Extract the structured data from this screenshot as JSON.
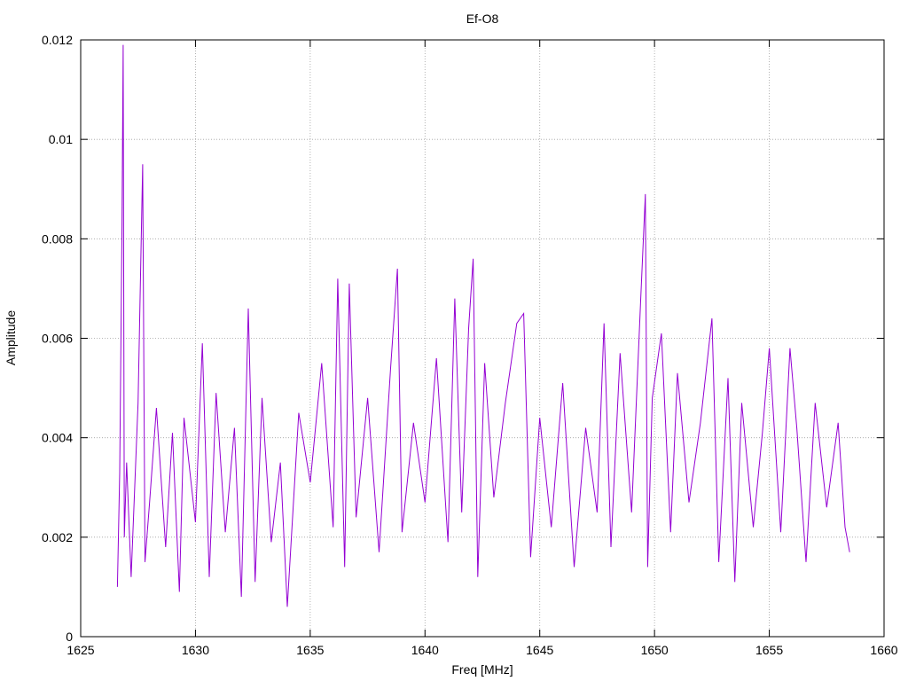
{
  "chart_data": {
    "type": "line",
    "title": "Ef-O8",
    "xlabel": "Freq [MHz]",
    "ylabel": "Amplitude",
    "xlim": [
      1625,
      1660
    ],
    "ylim": [
      0,
      0.012
    ],
    "xticks": [
      1625,
      1630,
      1635,
      1640,
      1645,
      1650,
      1655,
      1660
    ],
    "yticks": [
      0,
      0.002,
      0.004,
      0.006,
      0.008,
      0.01,
      0.012
    ],
    "xtick_labels": [
      "1625",
      "1630",
      "1635",
      "1640",
      "1645",
      "1650",
      "1655",
      "1660"
    ],
    "ytick_labels": [
      "0",
      "0.002",
      "0.004",
      "0.006",
      "0.008",
      "0.01",
      "0.012"
    ],
    "grid": true,
    "legend": "none",
    "line_color": "#9400d3",
    "series": [
      {
        "x": [
          1626.6,
          1626.7,
          1626.8,
          1626.85,
          1626.9,
          1627.0,
          1627.2,
          1627.5,
          1627.7,
          1627.8,
          1628.0,
          1628.3,
          1628.7,
          1629.0,
          1629.3,
          1629.5,
          1630.0,
          1630.3,
          1630.6,
          1630.9,
          1631.3,
          1631.7,
          1632.0,
          1632.3,
          1632.6,
          1632.9,
          1633.3,
          1633.7,
          1634.0,
          1634.5,
          1635.0,
          1635.5,
          1636.0,
          1636.2,
          1636.5,
          1636.7,
          1637.0,
          1637.5,
          1638.0,
          1638.5,
          1638.8,
          1639.0,
          1639.5,
          1640.0,
          1640.5,
          1641.0,
          1641.3,
          1641.6,
          1641.9,
          1642.1,
          1642.3,
          1642.6,
          1643.0,
          1643.5,
          1644.0,
          1644.3,
          1644.6,
          1645.0,
          1645.5,
          1646.0,
          1646.5,
          1647.0,
          1647.5,
          1647.8,
          1648.1,
          1648.5,
          1649.0,
          1649.4,
          1649.6,
          1649.7,
          1649.9,
          1650.3,
          1650.7,
          1651.0,
          1651.5,
          1652.0,
          1652.5,
          1652.8,
          1653.2,
          1653.5,
          1653.8,
          1654.3,
          1654.7,
          1655.0,
          1655.5,
          1655.9,
          1656.2,
          1656.6,
          1657.0,
          1657.5,
          1658.0,
          1658.3,
          1658.5
        ],
        "y": [
          0.001,
          0.0033,
          0.0083,
          0.0119,
          0.002,
          0.0035,
          0.0012,
          0.0047,
          0.0095,
          0.0015,
          0.0027,
          0.0046,
          0.0018,
          0.0041,
          0.0009,
          0.0044,
          0.0023,
          0.0059,
          0.0012,
          0.0049,
          0.0021,
          0.0042,
          0.0008,
          0.0066,
          0.0011,
          0.0048,
          0.0019,
          0.0035,
          0.0006,
          0.0045,
          0.0031,
          0.0055,
          0.0022,
          0.0072,
          0.0014,
          0.0071,
          0.0024,
          0.0048,
          0.0017,
          0.0054,
          0.0074,
          0.0021,
          0.0043,
          0.0027,
          0.0056,
          0.0019,
          0.0068,
          0.0025,
          0.0062,
          0.0076,
          0.0012,
          0.0055,
          0.0028,
          0.0047,
          0.0063,
          0.0065,
          0.0016,
          0.0044,
          0.0022,
          0.0051,
          0.0014,
          0.0042,
          0.0025,
          0.0063,
          0.0018,
          0.0057,
          0.0025,
          0.0068,
          0.0089,
          0.0014,
          0.0048,
          0.0061,
          0.0021,
          0.0053,
          0.0027,
          0.0043,
          0.0064,
          0.0015,
          0.0052,
          0.0011,
          0.0047,
          0.0022,
          0.0041,
          0.0058,
          0.0021,
          0.0058,
          0.0042,
          0.0015,
          0.0047,
          0.0026,
          0.0043,
          0.0022,
          0.0017
        ]
      }
    ]
  }
}
